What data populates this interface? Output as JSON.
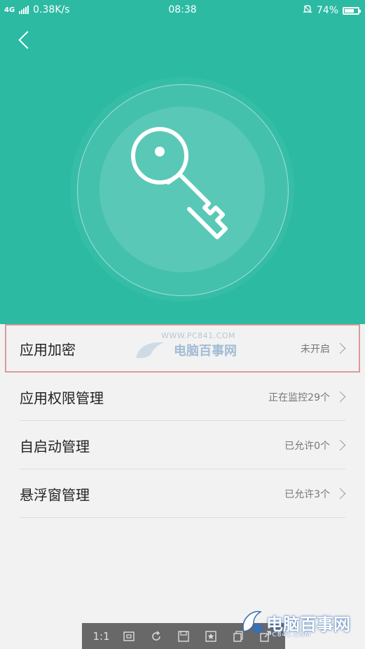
{
  "status_bar": {
    "network_badge": "4G",
    "speed": "0.38K/s",
    "time": "08:38",
    "battery": "74%",
    "battery_level": 0.74
  },
  "header": {
    "back_icon": "chevron-left-icon",
    "hero_icon": "key-icon"
  },
  "menu": {
    "items": [
      {
        "label": "应用加密",
        "value": "未开启"
      },
      {
        "label": "应用权限管理",
        "value": "正在监控29个"
      },
      {
        "label": "自启动管理",
        "value": "已允许0个"
      },
      {
        "label": "悬浮窗管理",
        "value": "已允许3个"
      }
    ]
  },
  "watermark": {
    "url": "WWW.PC841.COM",
    "name": "电脑百事网"
  },
  "toolbar": {
    "zoom": "1:1"
  },
  "brand": {
    "name": "电脑百事网",
    "url": "PC841.COM"
  },
  "colors": {
    "accent": "#2cbaa3",
    "background": "#f2f2f2"
  }
}
